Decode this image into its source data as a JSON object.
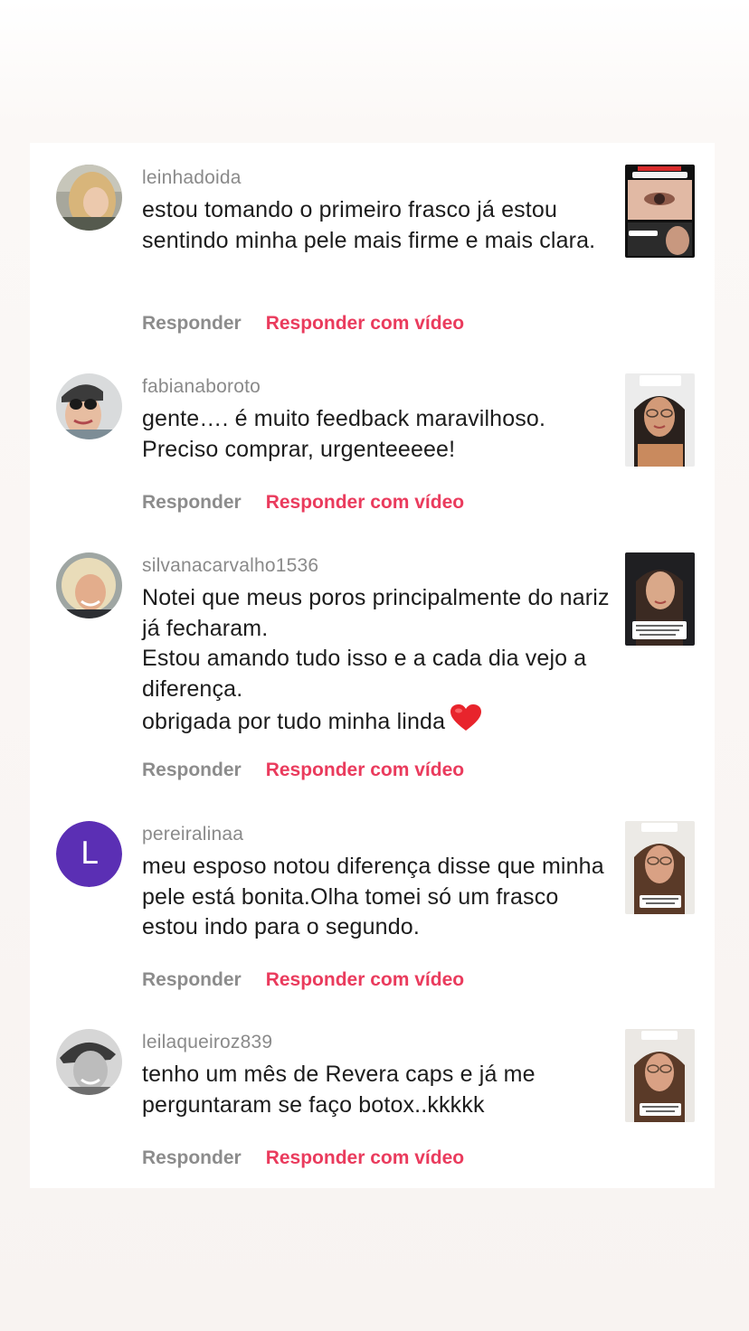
{
  "comments": [
    {
      "username": "leinhadoida",
      "text": "estou tomando o primeiro frasco já estou sentindo minha pele mais firme e mais clara.",
      "reply_label": "Responder",
      "reply_video_label": "Responder com vídeo"
    },
    {
      "username": "fabianaboroto",
      "text": "gente…. é muito feedback maravilhoso. Preciso comprar, urgenteeeee!",
      "reply_label": "Responder",
      "reply_video_label": "Responder com vídeo"
    },
    {
      "username": "silvanacarvalho1536",
      "text": "Notei que meus poros principalmente do nariz já fecharam.\nEstou amando tudo isso e a cada dia vejo a diferença.\nobrigada por tudo minha linda",
      "reply_label": "Responder",
      "reply_video_label": "Responder com vídeo"
    },
    {
      "username": "pereiralinaa",
      "avatar_letter": "L",
      "text": "meu esposo notou diferença disse que minha pele está bonita.Olha tomei só um frasco estou indo para o segundo.",
      "reply_label": "Responder",
      "reply_video_label": "Responder com vídeo"
    },
    {
      "username": "leilaqueiroz839",
      "text": "tenho um mês de Revera caps e já me perguntaram se faço botox..kkkkk",
      "reply_label": "Responder",
      "reply_video_label": "Responder com vídeo"
    }
  ],
  "colors": {
    "reply_video": "#ea3b5d",
    "reply": "#8c8c8c",
    "username": "#8a8a8a",
    "letter_avatar": "#5b2fb4"
  },
  "icons": [
    "heart-emoji-icon"
  ]
}
